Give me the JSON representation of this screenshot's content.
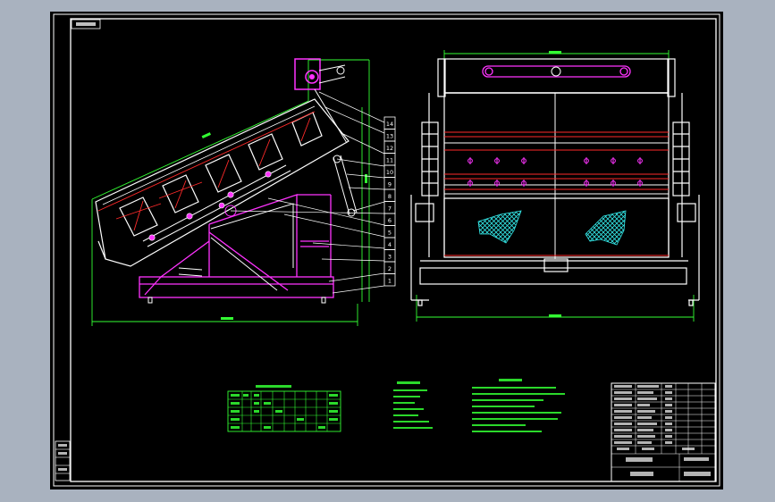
{
  "sheet": {
    "background": "#a9b2bf",
    "paper": "#000000",
    "frame_color": "#ffffff"
  },
  "colors": {
    "white": "#ffffff",
    "red": "#ff2a2a",
    "magenta": "#ff33ff",
    "green": "#33ff33",
    "cyan": "#33e6e6",
    "yellow": "#ffff33"
  },
  "callouts": [
    "14",
    "13",
    "12",
    "11",
    "10",
    "9",
    "8",
    "7",
    "6",
    "5",
    "4",
    "3",
    "2",
    "1"
  ],
  "icons": [
    "hatch-pattern-left",
    "hatch-pattern-right"
  ]
}
